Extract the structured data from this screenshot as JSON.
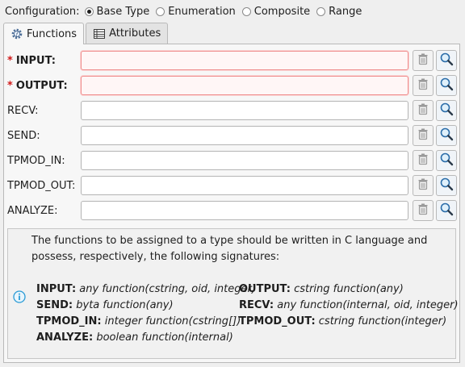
{
  "config": {
    "label": "Configuration:",
    "options": [
      "Base Type",
      "Enumeration",
      "Composite",
      "Range"
    ],
    "selected": "Base Type"
  },
  "tabs": [
    {
      "label": "Functions",
      "icon": "function-gear-icon",
      "active": true
    },
    {
      "label": "Attributes",
      "icon": "table-icon",
      "active": false
    }
  ],
  "fields": [
    {
      "label": "INPUT:",
      "required": true,
      "value": ""
    },
    {
      "label": "OUTPUT:",
      "required": true,
      "value": ""
    },
    {
      "label": "RECV:",
      "required": false,
      "value": ""
    },
    {
      "label": "SEND:",
      "required": false,
      "value": ""
    },
    {
      "label": "TPMOD_IN:",
      "required": false,
      "value": ""
    },
    {
      "label": "TPMOD_OUT:",
      "required": false,
      "value": ""
    },
    {
      "label": "ANALYZE:",
      "required": false,
      "value": ""
    }
  ],
  "required_marker": "*",
  "info": {
    "intro": "The functions to be assigned to a type should be written in C language and possess, respectively, the following signatures:",
    "signatures": [
      {
        "name": "INPUT:",
        "sig": "any function(cstring, oid, integer)"
      },
      {
        "name": "OUTPUT:",
        "sig": "cstring function(any)"
      },
      {
        "name": "SEND:",
        "sig": "byta function(any)"
      },
      {
        "name": "RECV:",
        "sig": "any function(internal, oid, integer)"
      },
      {
        "name": "TPMOD_IN:",
        "sig": "integer function(cstring[])"
      },
      {
        "name": "TPMOD_OUT:",
        "sig": "cstring function(integer)"
      },
      {
        "name": "ANALYZE:",
        "sig": "boolean function(internal)"
      }
    ]
  },
  "colors": {
    "required": "#d01818",
    "required_border": "#ef8c8c",
    "info_icon": "#2a9bd6"
  }
}
